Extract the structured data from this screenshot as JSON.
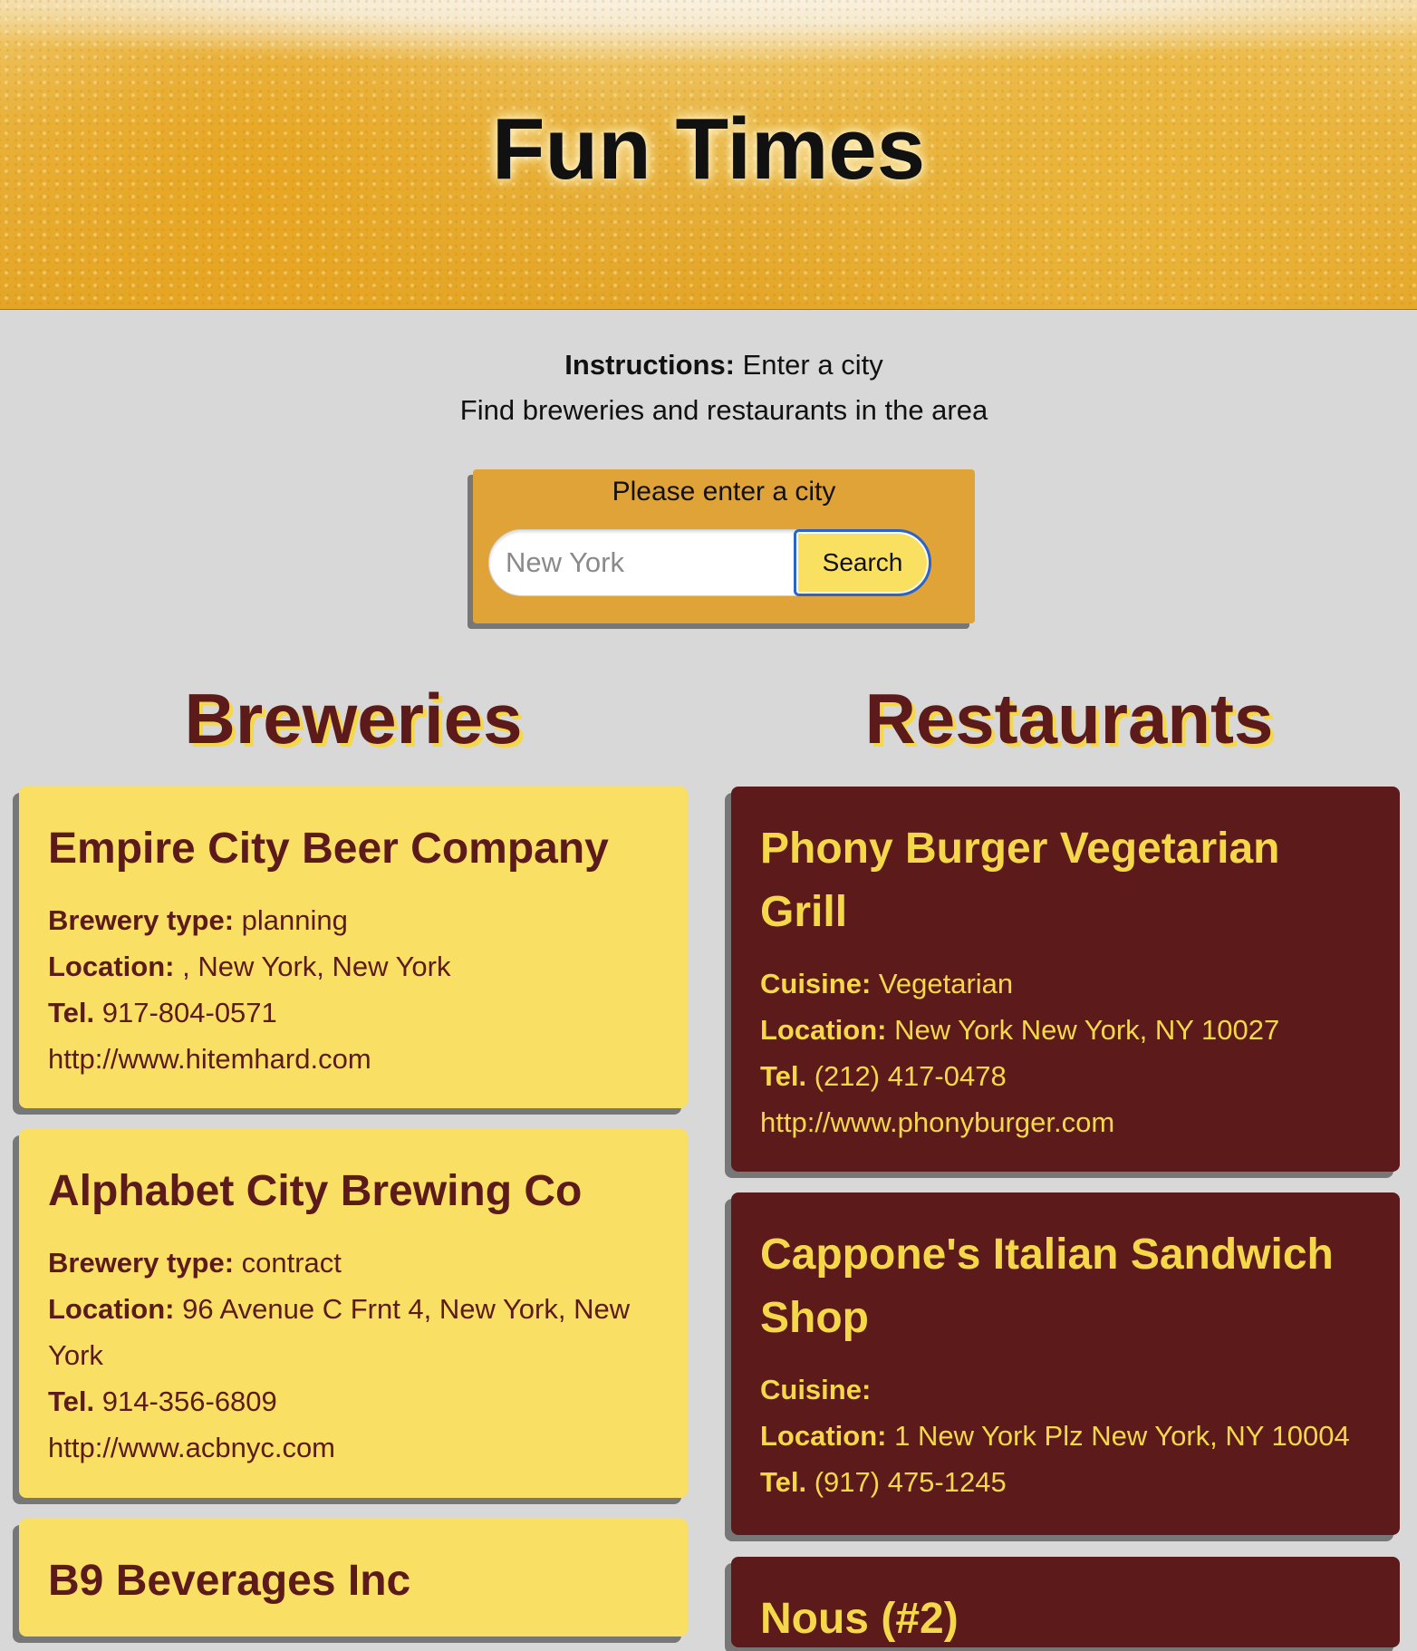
{
  "hero": {
    "title": "Fun Times"
  },
  "instructions": {
    "label": "Instructions:",
    "text": " Enter a city",
    "subtext": "Find breweries and restaurants in the area"
  },
  "search": {
    "label": "Please enter a city",
    "placeholder": "New York",
    "value": "",
    "button_label": "Search"
  },
  "breweries": {
    "heading": "Breweries",
    "items": [
      {
        "name": "Empire City Beer Company",
        "type_label": "Brewery type:",
        "type": " planning",
        "location_label": "Location:",
        "location": " , New York, New York",
        "tel_label": "Tel.",
        "tel": " 917-804-0571",
        "url": "http://www.hitemhard.com"
      },
      {
        "name": "Alphabet City Brewing Co",
        "type_label": "Brewery type:",
        "type": " contract",
        "location_label": "Location:",
        "location": " 96 Avenue C Frnt 4, New York, New York",
        "tel_label": "Tel.",
        "tel": " 914-356-6809",
        "url": "http://www.acbnyc.com"
      },
      {
        "name": "B9 Beverages Inc"
      }
    ]
  },
  "restaurants": {
    "heading": "Restaurants",
    "items": [
      {
        "name": "Phony Burger Vegetarian Grill",
        "cuisine_label": "Cuisine:",
        "cuisine": " Vegetarian",
        "location_label": "Location:",
        "location": " New York New York, NY 10027",
        "tel_label": "Tel.",
        "tel": " (212) 417-0478",
        "url": "http://www.phonyburger.com"
      },
      {
        "name": "Cappone's Italian Sandwich Shop",
        "cuisine_label": "Cuisine:",
        "cuisine": "",
        "location_label": "Location:",
        "location": " 1 New York Plz New York, NY 10004",
        "tel_label": "Tel.",
        "tel": " (917) 475-1245"
      },
      {
        "name": "Nous (#2)"
      }
    ]
  },
  "colors": {
    "page_bg": "#d8d8d8",
    "brewery_card_bg": "#f9e064",
    "restaurant_card_bg": "#5c1a1a",
    "accent_yellow": "#f4d84a",
    "maroon": "#5c1a1a",
    "search_panel": "#e0a338"
  }
}
